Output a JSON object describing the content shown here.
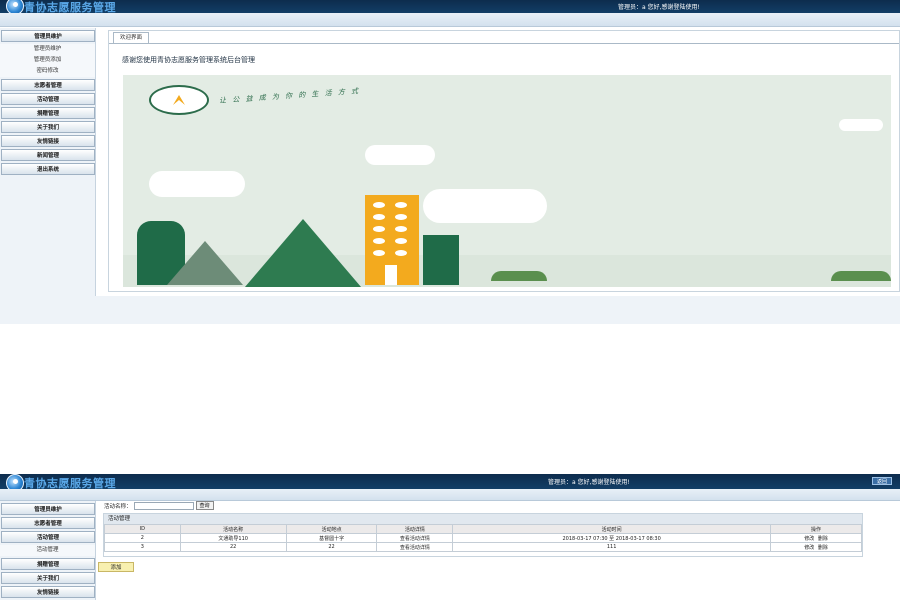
{
  "app": {
    "title": "青协志愿服务管理",
    "admin_greeting": "管理员：a 您好,感谢登陆使用!"
  },
  "screen1": {
    "sidebar": {
      "groups": [
        {
          "label": "管理员维护"
        },
        {
          "label": "管理员维护"
        },
        {
          "label": "管理员添加"
        },
        {
          "label": "密码修改"
        },
        {
          "label": "志愿者管理"
        },
        {
          "label": "活动管理"
        },
        {
          "label": "捐赠管理"
        },
        {
          "label": "关于我们"
        },
        {
          "label": "友情链接"
        },
        {
          "label": "新闻管理"
        },
        {
          "label": "退出系统"
        }
      ]
    },
    "tab_label": "欢迎界面",
    "welcome_text": "感谢您使用青协志愿服务管理系统后台管理",
    "slogan": "让 公 益 成 为 你 的 生 活 方 式"
  },
  "screen2": {
    "top_button": "返回",
    "sidebar": {
      "items": [
        {
          "label": "管理员维护"
        },
        {
          "label": "志愿者管理"
        },
        {
          "label": "活动管理"
        },
        {
          "label": "活动管理"
        },
        {
          "label": "捐赠管理"
        },
        {
          "label": "关于我们"
        },
        {
          "label": "友情链接"
        }
      ]
    },
    "search": {
      "label": "活动名称：",
      "value": "",
      "button": "查询"
    },
    "panel_title": "活动管理",
    "table": {
      "headers": [
        "ID",
        "活动名称",
        "活动地点",
        "活动详情",
        "活动时间",
        "操作"
      ],
      "rows": [
        {
          "id": "2",
          "name": "文通助导110",
          "place": "基督圆十字",
          "detail": "查看活动详情",
          "time": "2018-03-17 07:30 至 2018-03-17 08:30",
          "edit": "修改",
          "delete": "删除"
        },
        {
          "id": "3",
          "name": "22",
          "place": "22",
          "detail": "查看活动详情",
          "time": "111",
          "edit": "修改",
          "delete": "删除"
        }
      ]
    },
    "add_button": "添加"
  },
  "colors": {
    "header_bg": "#0d2c4d",
    "title_blue": "#5aa8e8",
    "tree_green": "#2e7b50",
    "building_orange": "#f3aa1e"
  }
}
